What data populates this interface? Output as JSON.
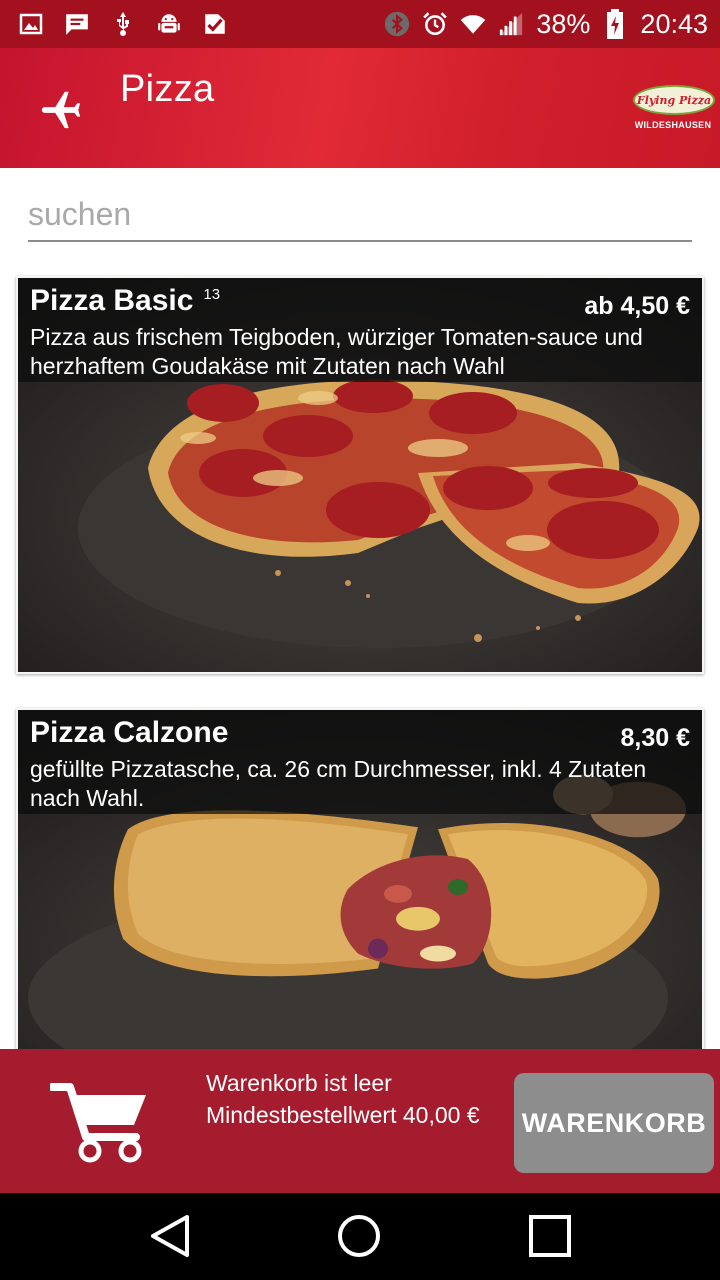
{
  "status_bar": {
    "battery": "38%",
    "time": "20:43",
    "icons": [
      "image-icon",
      "message-icon",
      "usb-icon",
      "android-icon",
      "task-icon",
      "bluetooth-icon",
      "alarm-icon",
      "wifi-icon",
      "signal-icon",
      "battery-icon"
    ]
  },
  "app_bar": {
    "title": "Pizza",
    "logo_text": "Flying Pizza",
    "logo_city": "WILDESHAUSEN"
  },
  "search": {
    "placeholder": "suchen"
  },
  "products": [
    {
      "name": "Pizza Basic",
      "footnote": "13",
      "price": "ab 4,50 €",
      "description": "Pizza aus frischem Teigboden, würziger Tomaten-sauce und herzhaftem Goudakäse mit Zutaten nach Wahl"
    },
    {
      "name": "Pizza Calzone",
      "footnote": "",
      "price": "8,30 €",
      "description": "gefüllte Pizzatasche, ca. 26 cm Durchmesser, inkl. 4 Zutaten nach Wahl."
    }
  ],
  "cart": {
    "status": "Warenkorb ist leer",
    "minimum": "Mindestbestellwert 40,00 €",
    "button_label": "WARENKORB"
  },
  "colors": {
    "status_bar": "#a3101e",
    "app_bar": "#d11f2c",
    "cart_bar": "#a51c2e",
    "cart_button": "#8d8d8d"
  }
}
